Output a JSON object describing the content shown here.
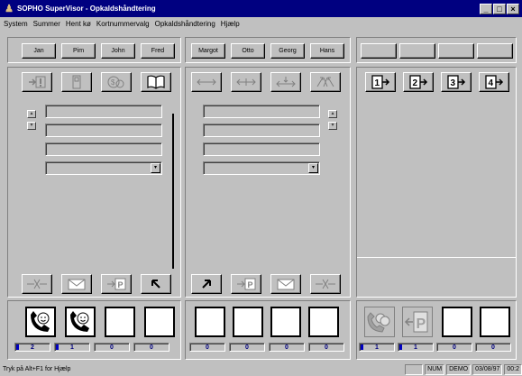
{
  "window": {
    "title": "SOPHO SuperVisor - Opkaldshåndtering",
    "minimize_label": "_",
    "maximize_label": "□",
    "close_label": "×"
  },
  "menu": [
    "System",
    "Summer",
    "Hent kø",
    "Kortnummervalg",
    "Opkaldshåndtering",
    "Hjælp"
  ],
  "operators_left": [
    "Jan",
    "Pim",
    "John",
    "Fred"
  ],
  "operators_right": [
    "Margot",
    "Otto",
    "Georg",
    "Hans"
  ],
  "queue_buttons": [
    "1",
    "2",
    "3",
    "4"
  ],
  "combo_arrow": "▾",
  "spin_up": "▴",
  "spin_down": "▾",
  "counters": {
    "left": [
      "2",
      "1",
      "0",
      "0"
    ],
    "middle": [
      "0",
      "0",
      "0",
      "0"
    ],
    "right": [
      "1",
      "1",
      "0",
      "0"
    ]
  },
  "status": {
    "hint": "Tryk på Alt+F1 for Hjælp",
    "num": "NUM",
    "mode": "DEMO",
    "date": "03/08/97",
    "time": "00:2"
  },
  "colors": {
    "titlebar": "#000080",
    "face": "#c0c0c0",
    "counter_text": "#000080",
    "indicator": "#0000c0"
  }
}
